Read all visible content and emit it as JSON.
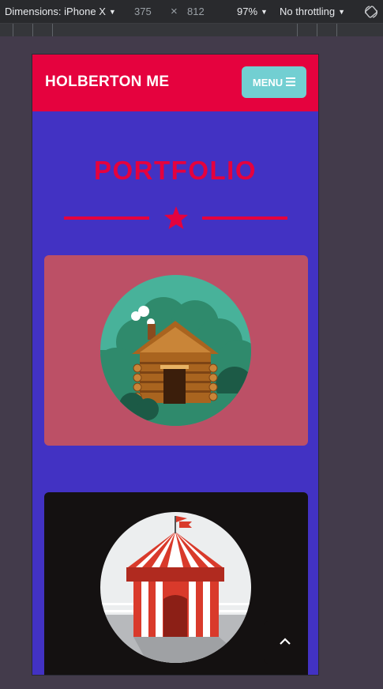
{
  "devtools": {
    "device_label": "Dimensions: iPhone X",
    "width": "375",
    "times": "×",
    "height": "812",
    "zoom": "97%",
    "throttling": "No throttling",
    "rotate_icon": "rotate-icon"
  },
  "site": {
    "logo": "HOLBERTON ME",
    "menu_label": "MENU",
    "menu_icon": "hamburger-icon",
    "section_title": "PORTFOLIO",
    "divider_icon": "star-icon",
    "to_top_icon": "chevron-up-icon"
  },
  "portfolio": [
    {
      "icon": "cabin-icon",
      "background": "#bc5066"
    },
    {
      "icon": "circus-tent-icon",
      "background": "#141111"
    }
  ],
  "colors": {
    "brand_red": "#e5023e",
    "page_bg": "#4232c3",
    "menu_bg": "#72cfd2"
  }
}
